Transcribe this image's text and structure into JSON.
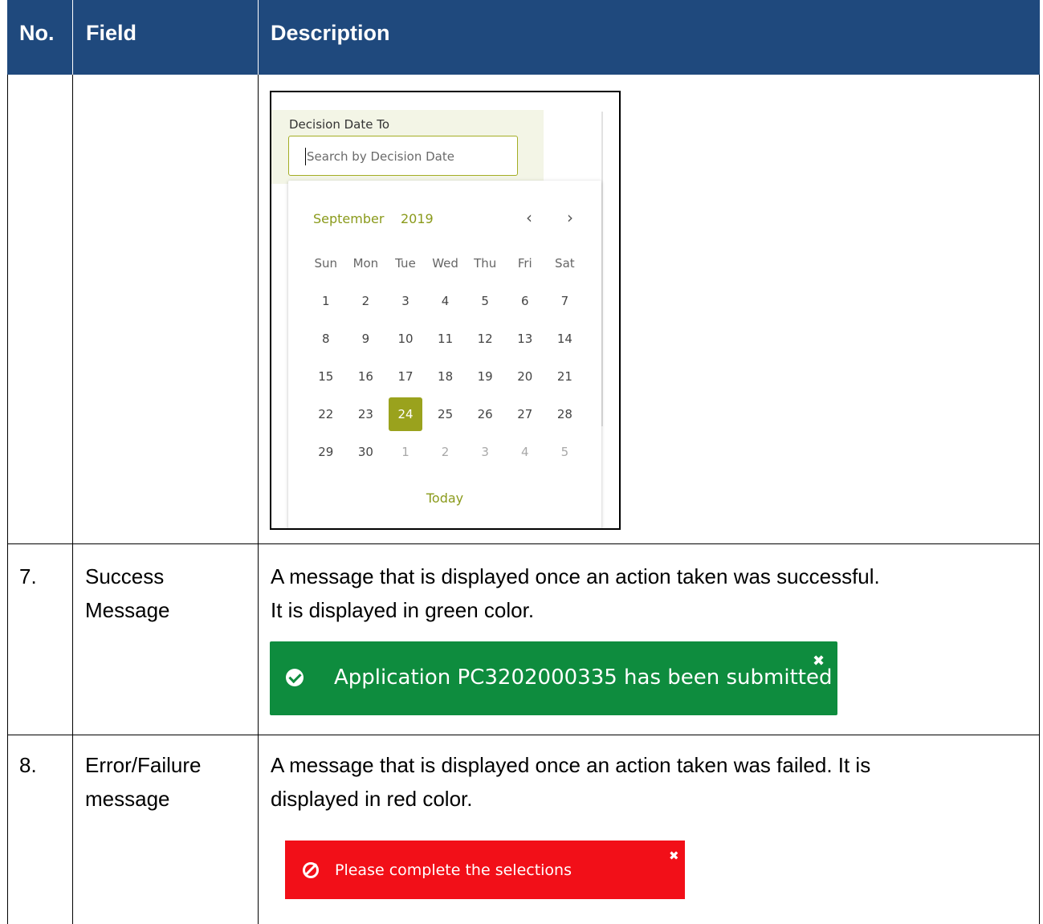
{
  "table": {
    "headers": {
      "no": "No.",
      "field": "Field",
      "description": "Description"
    },
    "rows": [
      {
        "no": "",
        "field_lines": [],
        "description_lines": []
      },
      {
        "no": "7.",
        "field_lines": [
          "Success",
          "Message"
        ],
        "description_lines": [
          "A message that is displayed once an action taken was successful.",
          "It is displayed in green color."
        ]
      },
      {
        "no": "8.",
        "field_lines": [
          "Error/Failure",
          "message"
        ],
        "description_lines": [
          "A message that is displayed once an action taken was failed. It is",
          "displayed in red color."
        ]
      }
    ]
  },
  "date_picker": {
    "label": "Decision Date To",
    "placeholder": "Search by Decision Date",
    "month": "September",
    "year": "2019",
    "prev_icon": "chevron-left-icon",
    "next_icon": "chevron-right-icon",
    "weekdays": [
      "Sun",
      "Mon",
      "Tue",
      "Wed",
      "Thu",
      "Fri",
      "Sat"
    ],
    "weeks": [
      [
        "1",
        "2",
        "3",
        "4",
        "5",
        "6",
        "7"
      ],
      [
        "8",
        "9",
        "10",
        "11",
        "12",
        "13",
        "14"
      ],
      [
        "15",
        "16",
        "17",
        "18",
        "19",
        "20",
        "21"
      ],
      [
        "22",
        "23",
        "24",
        "25",
        "26",
        "27",
        "28"
      ],
      [
        "29",
        "30",
        "1",
        "2",
        "3",
        "4",
        "5"
      ]
    ],
    "muted_days_in_last_week_from_index": 2,
    "selected_day": "24",
    "today_label": "Today",
    "accent_color": "#9aa21d"
  },
  "success_alert": {
    "icon": "check-circle-icon",
    "message": "Application PC3202000335 has been submitted",
    "close": "✖",
    "color": "#0e8c3e"
  },
  "error_alert": {
    "icon": "ban-icon",
    "message": "Please complete the selections",
    "close": "✖",
    "color": "#f20f18"
  },
  "header_color": "#1f497d"
}
